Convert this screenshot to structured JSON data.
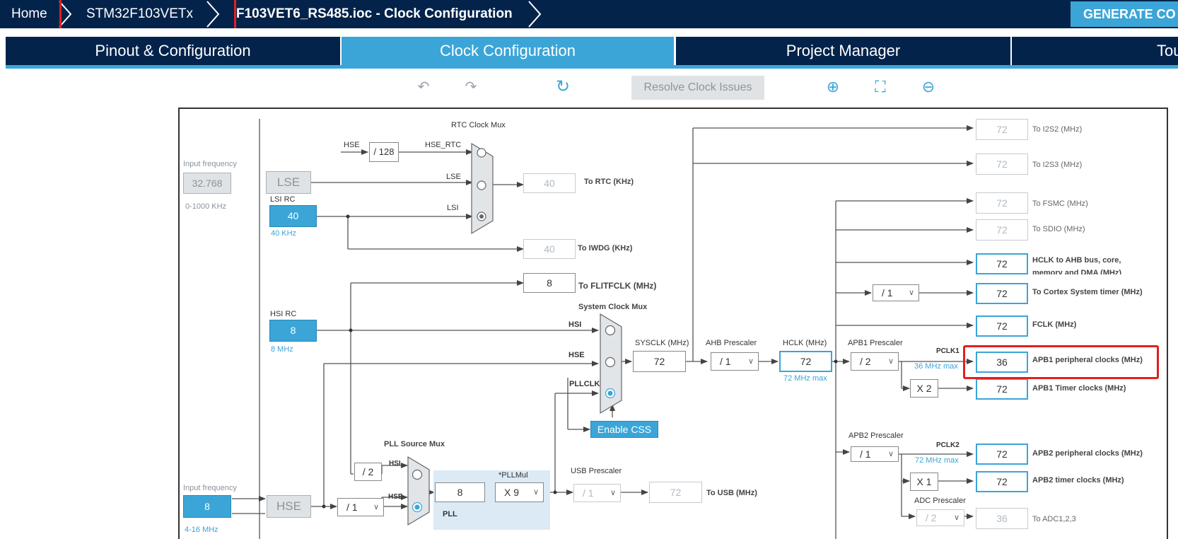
{
  "breadcrumb": {
    "home": "Home",
    "chip": "STM32F103VETx",
    "file": "F103VET6_RS485.ioc - Clock Configuration",
    "generate": "GENERATE CO"
  },
  "tabs": [
    "Pinout & Configuration",
    "Clock Configuration",
    "Project Manager",
    "Tou"
  ],
  "toolbar": {
    "undo_icon": "↶",
    "redo_icon": "↷",
    "reset_icon": "↻",
    "resolve": "Resolve Clock Issues",
    "zoom_in_icon": "⊕",
    "fit_icon": "⛶",
    "zoom_out_icon": "⊖"
  },
  "diagram": {
    "lse_input_label": "Input frequency",
    "lse_input_value": "32.768",
    "lse_range": "0-1000 KHz",
    "lse": "LSE",
    "lsi_rc": "LSI RC",
    "lsi_value": "40",
    "lsi_unit": "40 KHz",
    "rtc_mux": "RTC Clock Mux",
    "hse_text": "HSE",
    "div128": "/ 128",
    "hse_rtc": "HSE_RTC",
    "lse_text": "LSE",
    "lsi_text": "LSI",
    "rtc_value": "40",
    "rtc_label": "To RTC (KHz)",
    "iwdg_value": "40",
    "iwdg_label": "To IWDG (KHz)",
    "flit_value": "8",
    "flit_label": "To FLITFCLK (MHz)",
    "hsi_rc": "HSI RC",
    "hsi_value": "8",
    "hsi_unit": "8 MHz",
    "sys_mux": "System Clock Mux",
    "hsi_text": "HSI",
    "pllclk_text": "PLLCLK",
    "sysclk_label": "SYSCLK (MHz)",
    "sysclk_value": "72",
    "ahb_label": "AHB Prescaler",
    "ahb_value": "/ 1",
    "hclk_label": "HCLK (MHz)",
    "hclk_value": "72",
    "hclk_max": "72 MHz max",
    "enable_css": "Enable CSS",
    "pll_src_mux": "PLL Source Mux",
    "div2": "/ 2",
    "hse_input_label": "Input frequency",
    "hse_input_value": "8",
    "hse_range": "4-16 MHz",
    "hse": "HSE",
    "hse_div": "/ 1",
    "pll_in": "8",
    "pllmul_label": "*PLLMul",
    "pllmul_value": "X 9",
    "pll_label": "PLL",
    "usb_prescaler_label": "USB Prescaler",
    "usb_prescaler_value": "/ 1",
    "usb_value": "72",
    "usb_label": "To USB (MHz)",
    "apb1_label": "APB1 Prescaler",
    "apb1_value": "/ 2",
    "pclk1": "PCLK1",
    "pclk1_max": "36 MHz max",
    "apb1_timer_mult": "X 2",
    "apb2_label": "APB2 Prescaler",
    "apb2_value": "/ 1",
    "pclk2": "PCLK2",
    "pclk2_max": "72 MHz max",
    "apb2_timer_mult": "X 1",
    "adc_label": "ADC Prescaler",
    "adc_value": "/ 2",
    "cortex_div": "/ 1",
    "outputs": [
      {
        "value": "72",
        "label": "To I2S2 (MHz)",
        "bold": false,
        "active": false
      },
      {
        "value": "72",
        "label": "To I2S3 (MHz)",
        "bold": false,
        "active": false
      },
      {
        "value": "72",
        "label": "To FSMC (MHz)",
        "bold": false,
        "active": false
      },
      {
        "value": "72",
        "label": "To SDIO (MHz)",
        "bold": false,
        "active": false
      },
      {
        "value": "72",
        "label": "HCLK to AHB bus, core,",
        "label2": "memory and DMA (MHz)",
        "bold": true,
        "active": true
      },
      {
        "value": "72",
        "label": "To Cortex System timer (MHz)",
        "bold": true,
        "active": true
      },
      {
        "value": "72",
        "label": "FCLK (MHz)",
        "bold": true,
        "active": true
      },
      {
        "value": "36",
        "label": "APB1 peripheral clocks (MHz)",
        "bold": true,
        "active": true
      },
      {
        "value": "72",
        "label": "APB1 Timer clocks (MHz)",
        "bold": true,
        "active": true
      },
      {
        "value": "72",
        "label": "APB2 peripheral clocks (MHz)",
        "bold": true,
        "active": true
      },
      {
        "value": "72",
        "label": "APB2 timer clocks (MHz)",
        "bold": true,
        "active": true
      },
      {
        "value": "36",
        "label": "To ADC1,2,3",
        "bold": false,
        "active": false
      }
    ]
  },
  "colors": {
    "nav": "#03234b",
    "accent": "#3ba5d8",
    "highlight": "#e02020",
    "line": "#555555"
  }
}
